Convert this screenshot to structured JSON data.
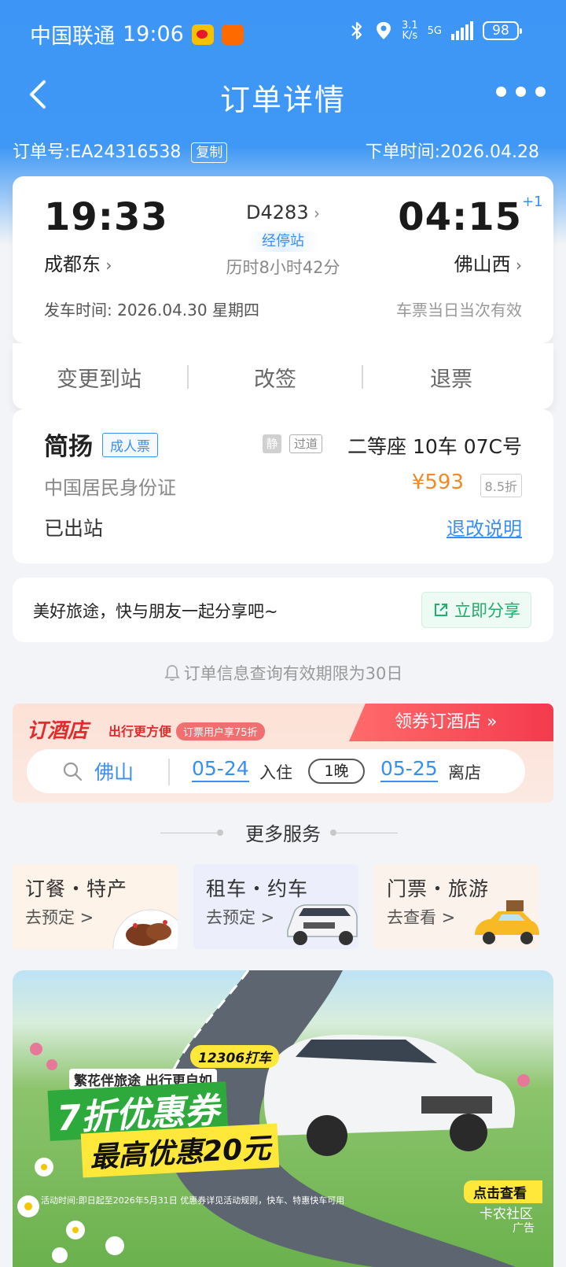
{
  "status_bar": {
    "carrier": "中国联通",
    "time": "19:06",
    "net_speed_value": "3.1",
    "net_speed_unit": "K/s",
    "network": "5G",
    "battery": "98"
  },
  "nav": {
    "title": "订单详情"
  },
  "order": {
    "number_label": "订单号:EA24316538",
    "copy_label": "复制",
    "order_time": "下单时间:2026.04.28"
  },
  "trip": {
    "depart_time": "19:33",
    "depart_station": "成都东",
    "train_no": "D4283",
    "via_label": "经停站",
    "duration": "历时8小时42分",
    "arrive_time": "04:15",
    "arrive_station": "佛山西",
    "day_offset": "+1",
    "depart_date_line": "发车时间:  2026.04.30 星期四",
    "validity": "车票当日当次有效"
  },
  "actions": {
    "change_station": "变更到站",
    "reschedule": "改签",
    "refund": "退票"
  },
  "passenger": {
    "name": "简扬",
    "ticket_type": "成人票",
    "quiet_tag": "静",
    "aisle_tag": "过道",
    "seat": "二等座 10车 07C号",
    "id_type": "中国居民身份证",
    "price": "¥593",
    "discount": "8.5折",
    "status": "已出站",
    "refund_rules": "退改说明"
  },
  "share": {
    "text": "美好旅途，快与朋友一起分享吧~",
    "button": "立即分享"
  },
  "validity_note": "订单信息查询有效期限为30日",
  "hotel": {
    "logo": "订酒店",
    "slogan": "出行更方便",
    "promo": "订票用户享75折",
    "ribbon": "领券订酒店 »",
    "city": "佛山",
    "checkin_date": "05-24",
    "checkin_label": "入住",
    "nights": "1晚",
    "checkout_date": "05-25",
    "checkout_label": "离店"
  },
  "more_services": {
    "title": "更多服务",
    "items": [
      {
        "title": "订餐・特产",
        "sub": "去预定 >"
      },
      {
        "title": "租车・约车",
        "sub": "去预定 >"
      },
      {
        "title": "门票・旅游",
        "sub": "去查看 >"
      }
    ]
  },
  "ad": {
    "tag": "12306打车",
    "subtitle": "繁花伴旅途 出行更自如",
    "headline1": "7折优惠券",
    "headline2": "最高优惠20元",
    "note": "活动时间:即日起至2026年5月31日 优惠券详见活动规则，快车、特惠快车可用",
    "cta": "点击查看",
    "brand": "卡农社区",
    "label": "广告"
  },
  "colors": {
    "primary_blue": "#3d95f5",
    "price_orange": "#f08a24",
    "share_green": "#1fae6b",
    "hotel_red": "#e02c2c"
  }
}
